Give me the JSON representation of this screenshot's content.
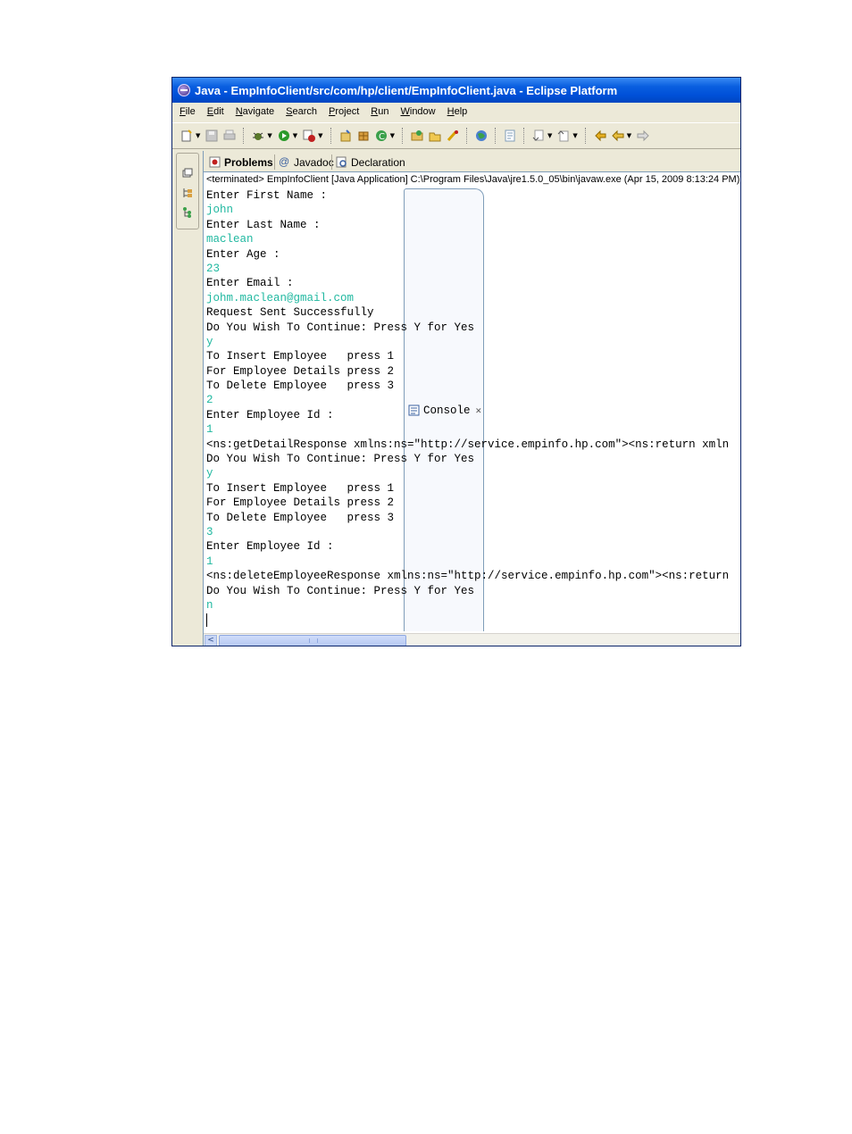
{
  "window": {
    "title": "Java - EmpInfoClient/src/com/hp/client/EmpInfoClient.java - Eclipse Platform"
  },
  "menu": [
    {
      "key": "F",
      "rest": "ile"
    },
    {
      "key": "E",
      "rest": "dit"
    },
    {
      "key": "N",
      "rest": "avigate"
    },
    {
      "key": "S",
      "rest": "earch"
    },
    {
      "key": "P",
      "rest": "roject"
    },
    {
      "key": "R",
      "rest": "un"
    },
    {
      "key": "W",
      "rest": "indow"
    },
    {
      "key": "H",
      "rest": "elp"
    }
  ],
  "tabs": {
    "problems": "Problems",
    "javadoc": "Javadoc",
    "declaration": "Declaration",
    "console": "Console"
  },
  "console": {
    "status": "<terminated> EmpInfoClient [Java Application] C:\\Program Files\\Java\\jre1.5.0_05\\bin\\javaw.exe (Apr 15, 2009 8:13:24 PM)",
    "lines": [
      {
        "text": "Enter First Name :",
        "input": false
      },
      {
        "text": "john",
        "input": true
      },
      {
        "text": "Enter Last Name :",
        "input": false
      },
      {
        "text": "maclean",
        "input": true
      },
      {
        "text": "Enter Age :",
        "input": false
      },
      {
        "text": "23",
        "input": true
      },
      {
        "text": "Enter Email :",
        "input": false
      },
      {
        "text": "johm.maclean@gmail.com",
        "input": true
      },
      {
        "text": "Request Sent Successfully",
        "input": false
      },
      {
        "text": "Do You Wish To Continue: Press Y for Yes",
        "input": false
      },
      {
        "text": "y",
        "input": true
      },
      {
        "text": "To Insert Employee   press 1",
        "input": false
      },
      {
        "text": "For Employee Details press 2",
        "input": false
      },
      {
        "text": "To Delete Employee   press 3",
        "input": false
      },
      {
        "text": "2",
        "input": true
      },
      {
        "text": "Enter Employee Id :",
        "input": false
      },
      {
        "text": "1",
        "input": true
      },
      {
        "text": "<ns:getDetailResponse xmlns:ns=\"http://service.empinfo.hp.com\"><ns:return xmln",
        "input": false
      },
      {
        "text": "Do You Wish To Continue: Press Y for Yes",
        "input": false
      },
      {
        "text": "y",
        "input": true
      },
      {
        "text": "To Insert Employee   press 1",
        "input": false
      },
      {
        "text": "For Employee Details press 2",
        "input": false
      },
      {
        "text": "To Delete Employee   press 3",
        "input": false
      },
      {
        "text": "3",
        "input": true
      },
      {
        "text": "Enter Employee Id :",
        "input": false
      },
      {
        "text": "1",
        "input": true
      },
      {
        "text": "<ns:deleteEmployeeResponse xmlns:ns=\"http://service.empinfo.hp.com\"><ns:return",
        "input": false
      },
      {
        "text": "Do You Wish To Continue: Press Y for Yes",
        "input": false
      },
      {
        "text": "n",
        "input": true
      }
    ]
  },
  "icons": {
    "toolbar": [
      "new-icon",
      "save-icon",
      "print-icon",
      "debug-icon",
      "run-icon",
      "external-tools-icon",
      "new-java-project-icon",
      "new-package-icon",
      "new-class-icon",
      "open-type-icon",
      "open-folder-icon",
      "search-icon",
      "web-icon",
      "annotation-icon",
      "next-annotation-icon",
      "prev-annotation-icon",
      "last-edit-icon",
      "back-icon",
      "forward-icon"
    ]
  },
  "colors": {
    "input_text": "#20b8a0",
    "title_bar": "#0050d8"
  }
}
